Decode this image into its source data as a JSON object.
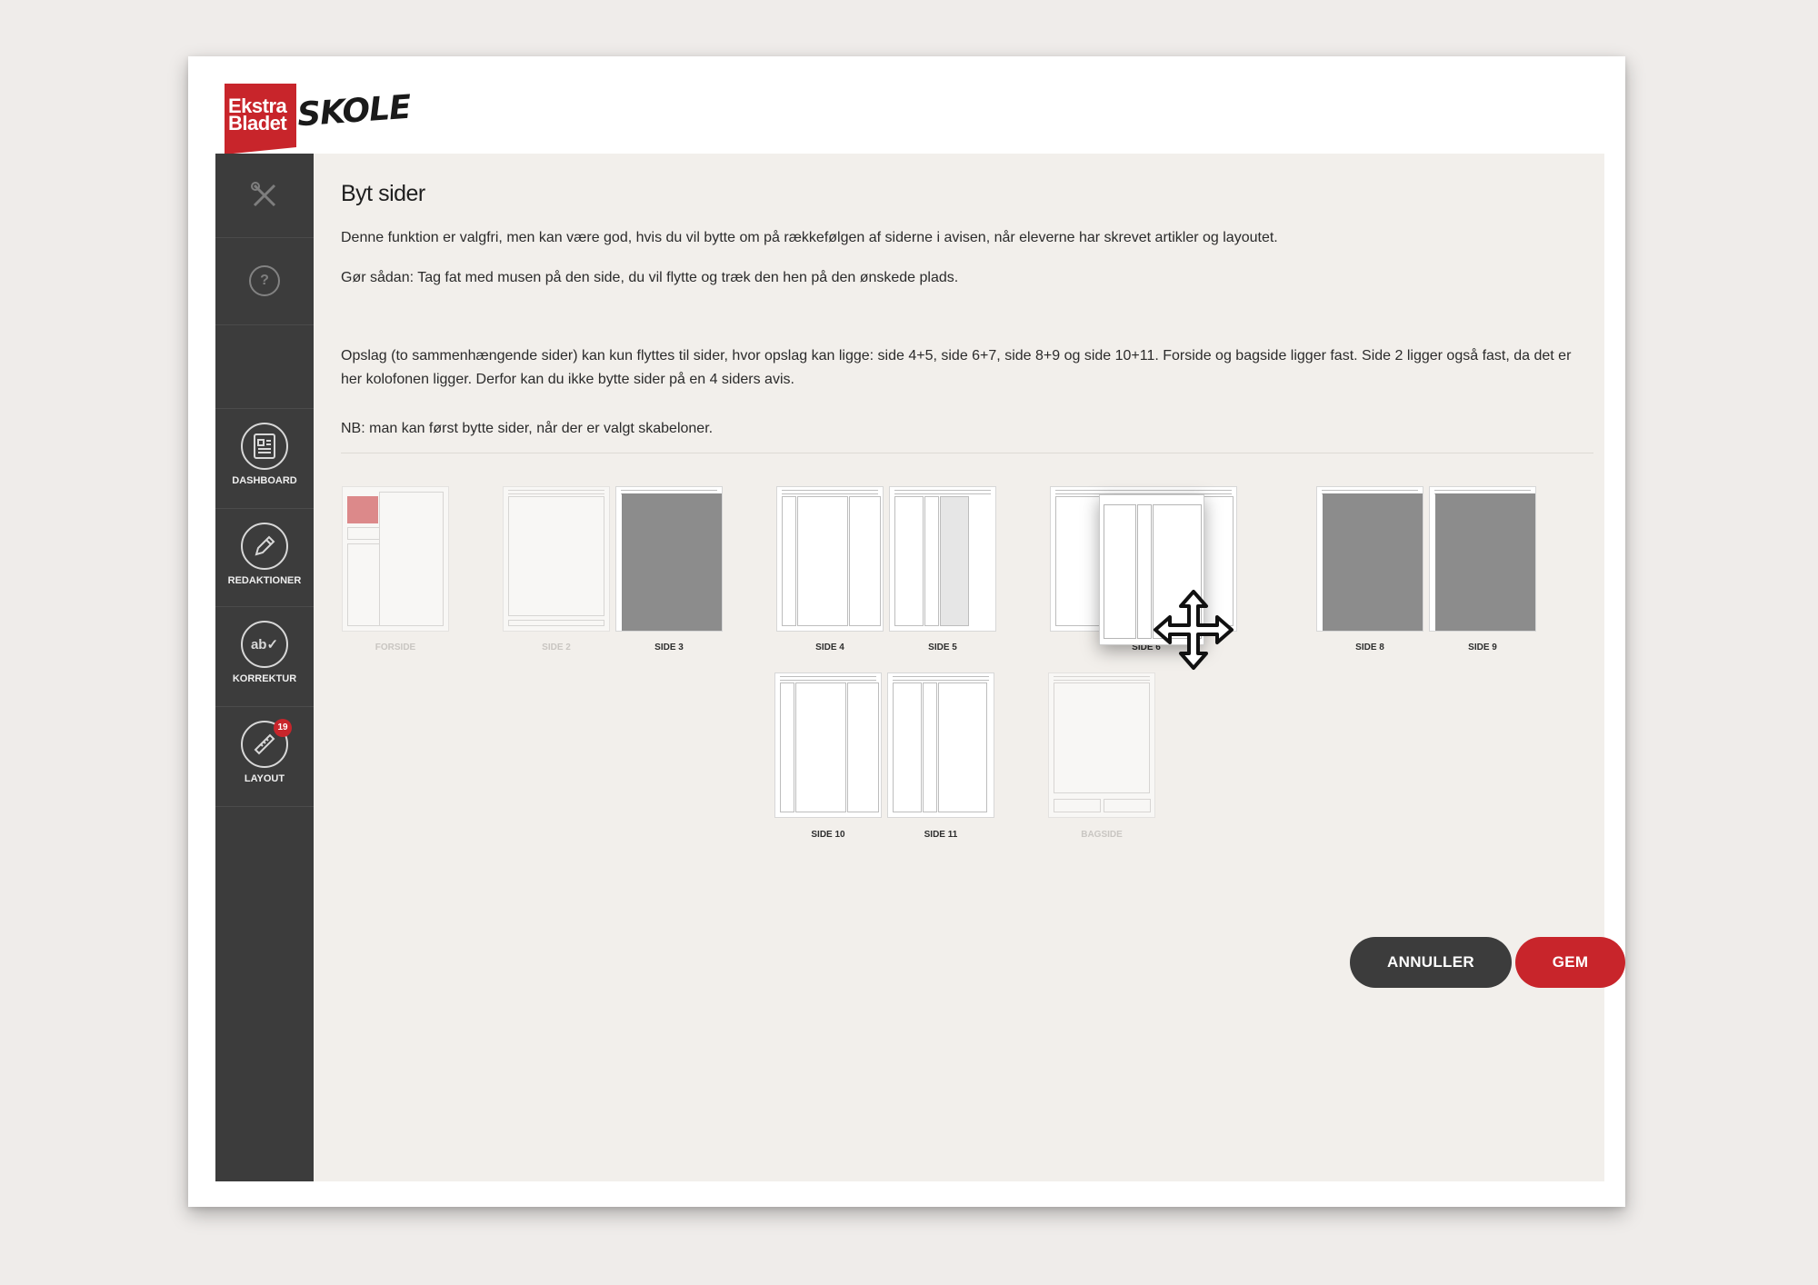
{
  "logo": {
    "brand_line1": "Ekstra",
    "brand_line2": "Bladet",
    "product": "SKOLE"
  },
  "sidebar": {
    "items": [
      {
        "label": "DASHBOARD",
        "icon": "dashboard-icon"
      },
      {
        "label": "REDAKTIONER",
        "icon": "pencil-icon"
      },
      {
        "label": "KORREKTUR",
        "icon": "spellcheck-icon"
      },
      {
        "label": "LAYOUT",
        "icon": "ruler-icon",
        "badge": "19"
      }
    ]
  },
  "main": {
    "title": "Byt sider",
    "paragraph1": "Denne funktion er valgfri, men kan være god, hvis du vil bytte om på rækkefølgen af siderne i avisen, når eleverne har skrevet artikler og layoutet.",
    "paragraph2": "Gør sådan: Tag fat med musen på den side, du vil flytte og træk den hen på den ønskede plads.",
    "paragraph3": "Opslag (to sammenhængende sider) kan kun flyttes til sider, hvor opslag kan ligge: side 4+5, side 6+7, side 8+9 og side 10+11. Forside og bagside ligger fast. Side 2 ligger også fast, da det er her kolofonen ligger. Derfor kan du ikke bytte sider på en 4 siders avis.",
    "paragraph4": "NB: man kan først bytte sider, når der er valgt skabeloner."
  },
  "pages": {
    "forside": "FORSIDE",
    "side2": "SIDE 2",
    "side3": "SIDE 3",
    "side4": "SIDE 4",
    "side5": "SIDE 5",
    "side6": "SIDE 6",
    "side8": "SIDE 8",
    "side9": "SIDE 9",
    "side10": "SIDE 10",
    "side11": "SIDE 11",
    "bagside": "BAGSIDE"
  },
  "buttons": {
    "cancel": "ANNULLER",
    "save": "GEM"
  },
  "colors": {
    "brand_red": "#c8252b",
    "sidebar_dark": "#3c3c3c",
    "content_bg": "#f2efeb"
  }
}
